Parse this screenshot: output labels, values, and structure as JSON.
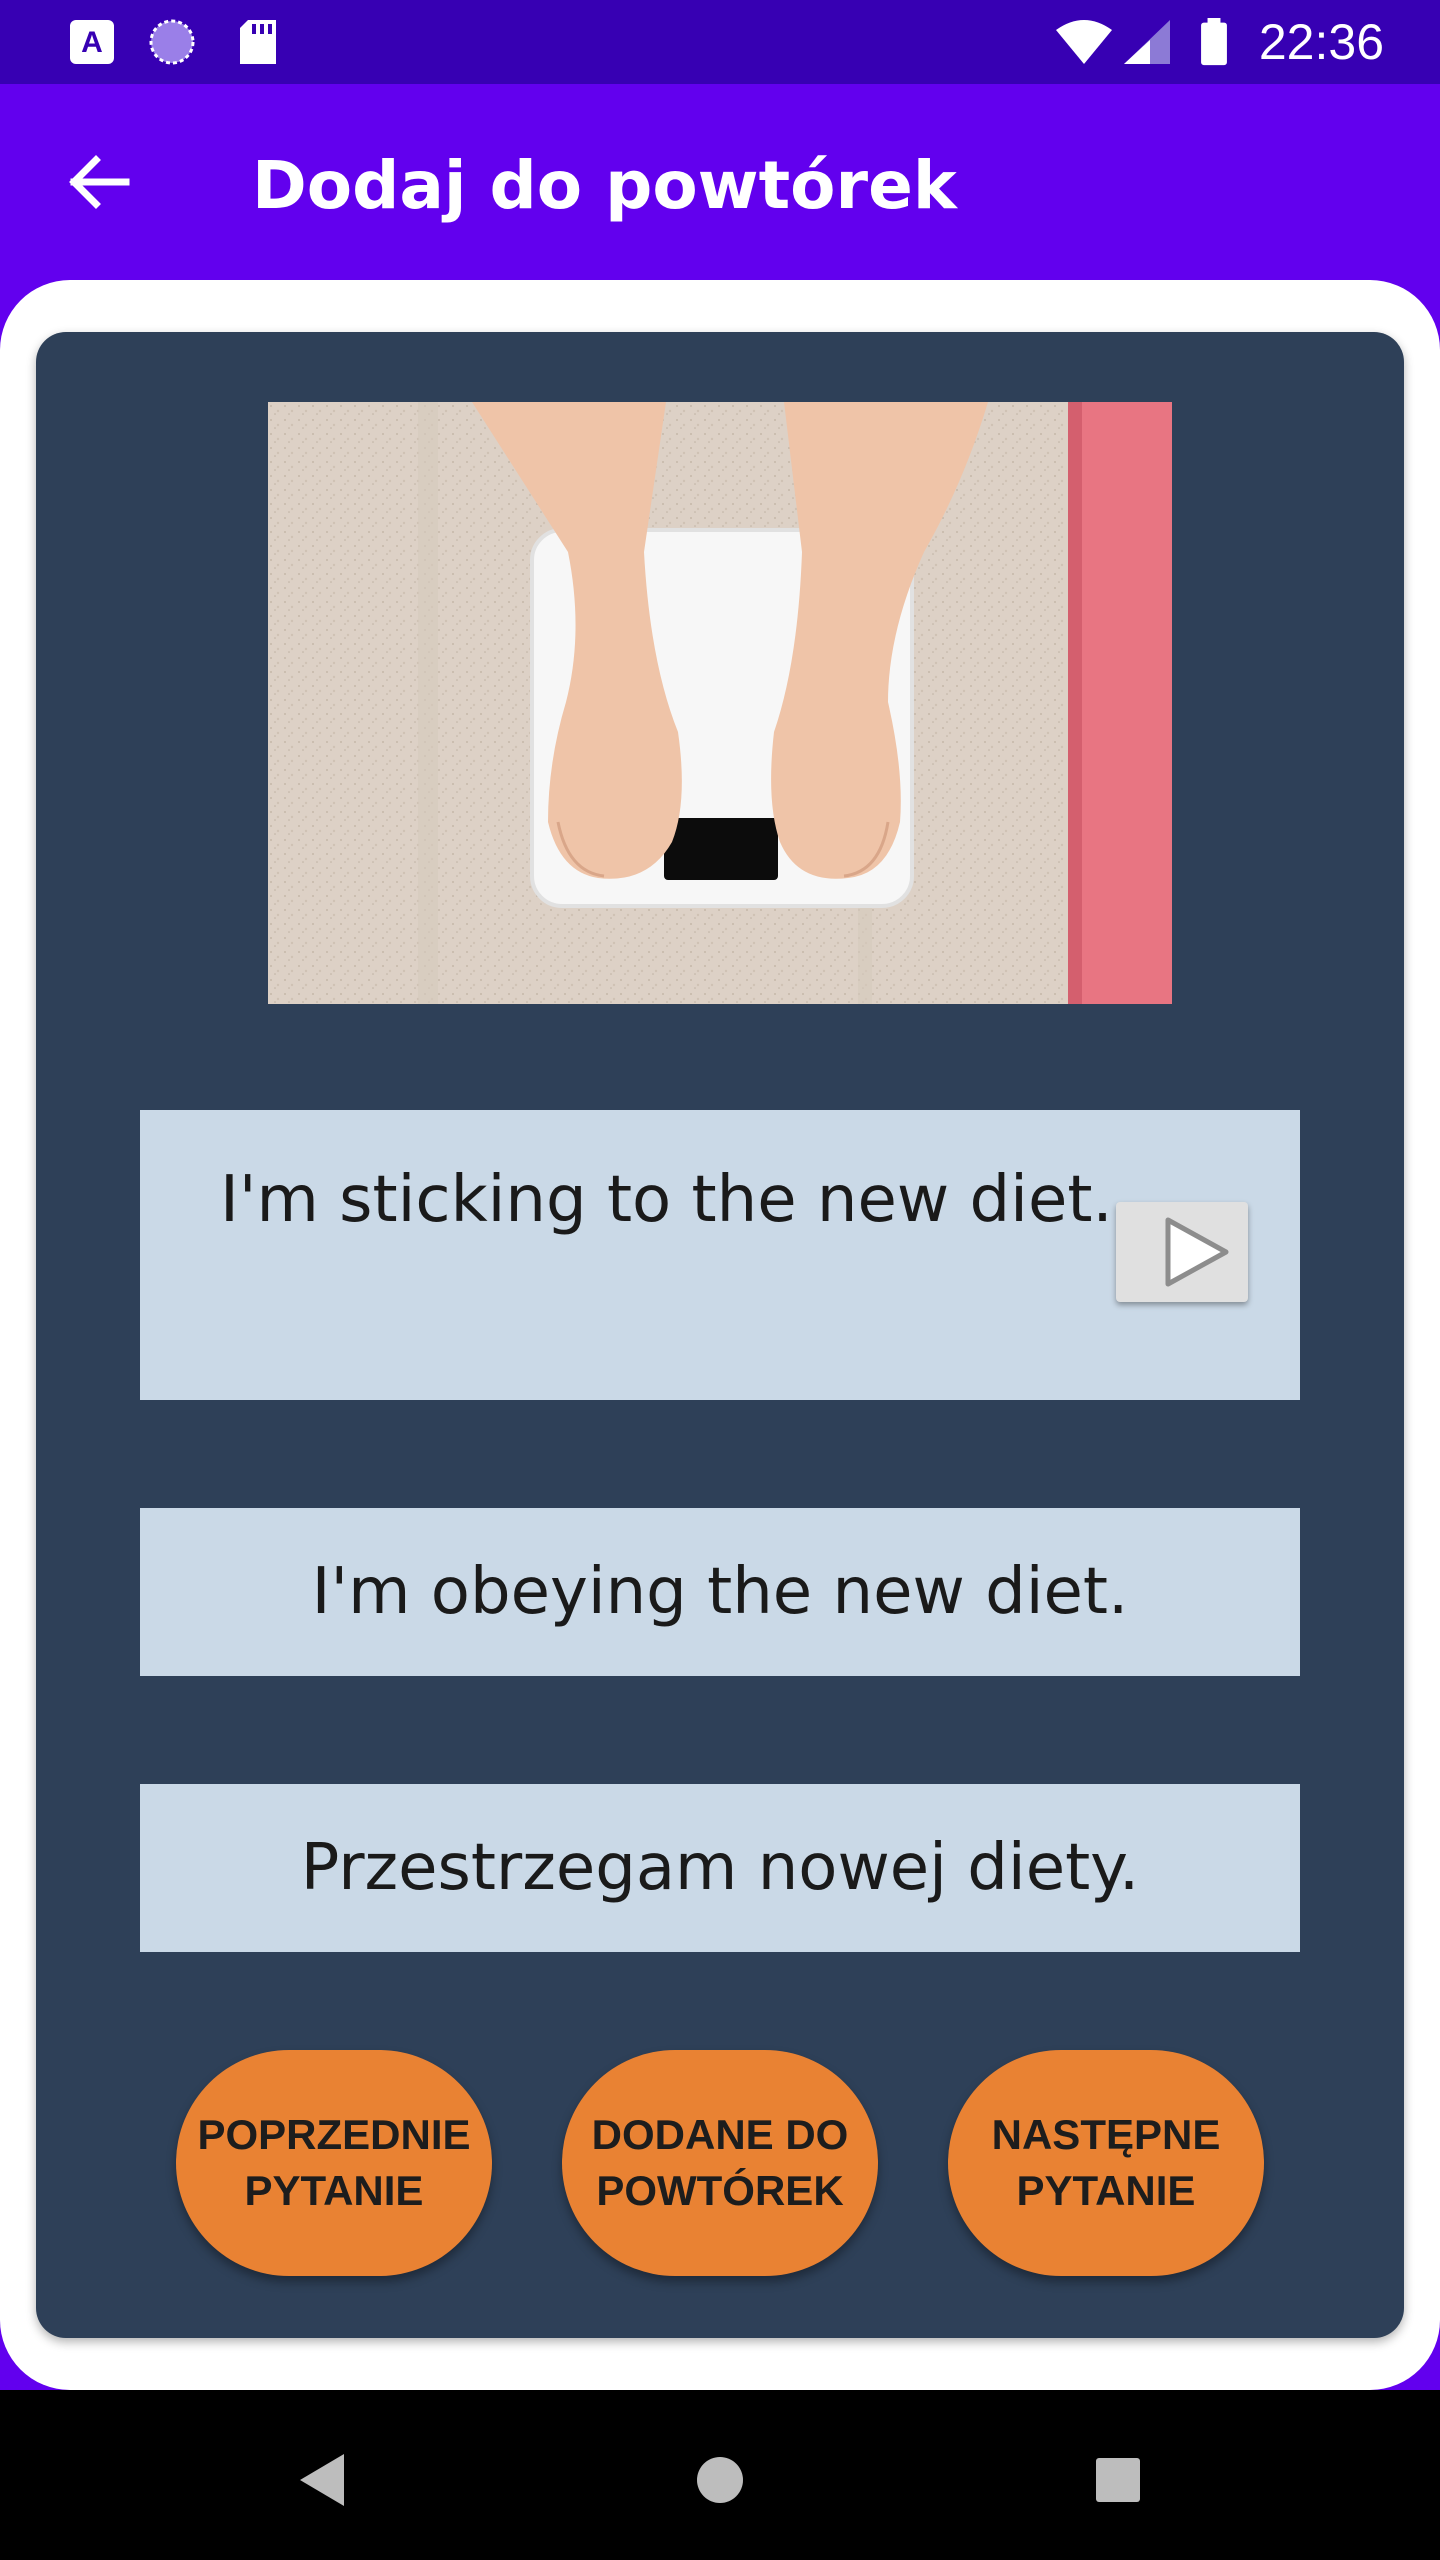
{
  "status_bar": {
    "time": "22:36",
    "icons": [
      "a-keyboard-icon",
      "loading-circle-icon",
      "sd-card-icon",
      "wifi-icon",
      "signal-icon",
      "battery-icon"
    ]
  },
  "app_bar": {
    "back_icon": "arrow-left-icon",
    "title": "Dodaj do powtórek"
  },
  "card": {
    "sentence_english": "I'm sticking to the new diet.",
    "play_icon": "play-icon",
    "sentence_alternative": "I'm obeying the new diet.",
    "sentence_polish": "Przestrzegam nowej diety."
  },
  "buttons": {
    "previous": "POPRZEDNIE\nPYTANIE",
    "added": "DODANE DO\nPOWTÓREK",
    "next": "NASTĘPNE\nPYTANIE"
  },
  "colors": {
    "status_bar": "#3700b3",
    "app_bar": "#6200ee",
    "card_bg": "#2e4058",
    "sentence_bg": "#cad9e7",
    "button_bg": "#e98233"
  },
  "nav_bar": {
    "icons": [
      "nav-back-icon",
      "nav-home-icon",
      "nav-recents-icon"
    ]
  }
}
